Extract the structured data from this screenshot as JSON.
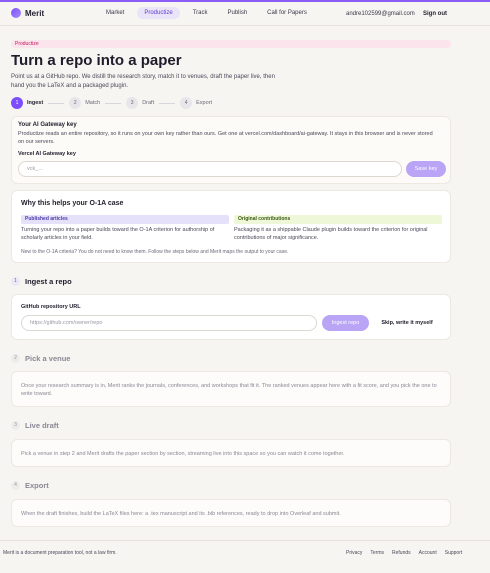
{
  "nav": {
    "logo": "Merit",
    "links": [
      "Market",
      "Productize",
      "Track",
      "Publish",
      "Call for Papers"
    ],
    "active_index": 1,
    "email": "andre102599@gmail.com",
    "sign_out": "Sign out"
  },
  "hero": {
    "badge": "Productize",
    "title": "Turn a repo into a paper",
    "subtitle": "Point us at a GitHub repo. We distill the research story, match it to venues, draft the paper live, then hand you the LaTeX and a packaged plugin."
  },
  "stepper": [
    {
      "num": "1",
      "label": "Ingest",
      "active": true
    },
    {
      "num": "2",
      "label": "Match",
      "active": false
    },
    {
      "num": "3",
      "label": "Draft",
      "active": false
    },
    {
      "num": "4",
      "label": "Export",
      "active": false
    }
  ],
  "gateway": {
    "title": "Your AI Gateway key",
    "description": "Productize reads an entire repository, so it runs on your own key rather than ours. Get one at vercel.com/dashboard/ai-gateway. It stays in this browser and is never stored on our servers.",
    "field_label": "Vercel AI Gateway key",
    "placeholder": "vck_...",
    "save_label": "Save key"
  },
  "why": {
    "title": "Why this helps your O-1A case",
    "col1_tag": "Published articles",
    "col1_text": "Turning your repo into a paper builds toward the O-1A criterion for authorship of scholarly articles in your field.",
    "col2_tag": "Original contributions",
    "col2_text": "Packaging it as a shippable Claude plugin builds toward the criterion for original contributions of major significance.",
    "footnote": "New to the O-1A criteria? You do not need to know them. Follow the steps below and Merit maps the output to your case."
  },
  "ingest": {
    "num": "1",
    "title": "Ingest a repo",
    "field_label": "GitHub repository URL",
    "placeholder": "https://github.com/owner/repo",
    "ingest_label": "Ingest repo",
    "skip_label": "Skip, write it myself"
  },
  "venue": {
    "num": "2",
    "title": "Pick a venue",
    "text": "Once your research summary is in, Merit ranks the journals, conferences, and workshops that fit it. The ranked venues appear here with a fit score, and you pick the one to write toward."
  },
  "draft": {
    "num": "3",
    "title": "Live draft",
    "text": "Pick a venue in step 2 and Merit drafts the paper section by section, streaming live into this space so you can watch it come together."
  },
  "export": {
    "num": "4",
    "title": "Export",
    "text": "When the draft finishes, build the LaTeX files here: a .tex manuscript and its .bib references, ready to drop into Overleaf and submit."
  },
  "footer": {
    "disclaimer": "Merit is a document preparation tool, not a law firm.",
    "links": [
      "Privacy",
      "Terms",
      "Refunds",
      "Account",
      "Support"
    ]
  }
}
